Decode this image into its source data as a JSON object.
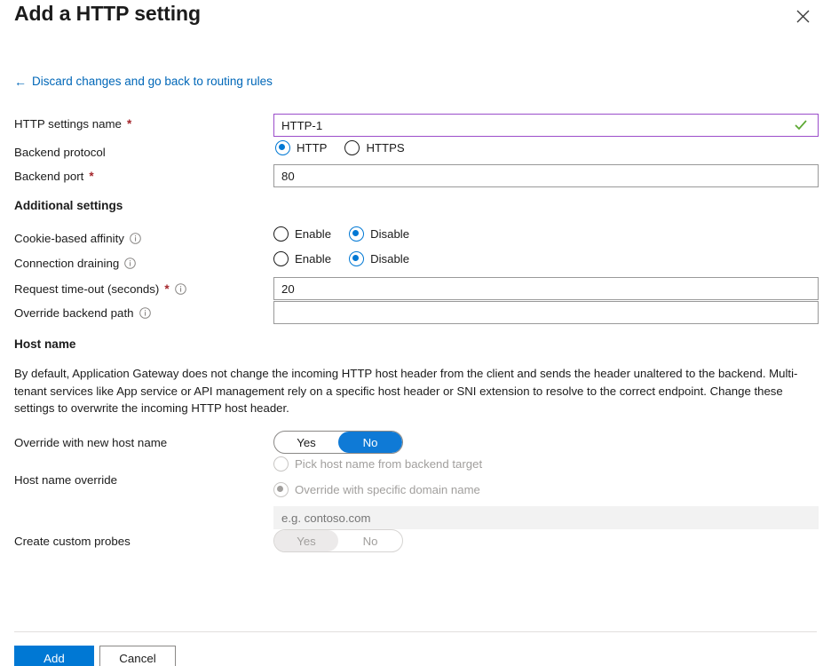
{
  "header": {
    "title": "Add a HTTP setting",
    "close_icon": "close-icon"
  },
  "back_link": {
    "arrow": "←",
    "label": "Discard changes and go back to routing rules"
  },
  "form": {
    "http_settings_name": {
      "label": "HTTP settings name",
      "required_marker": "*",
      "value": "HTTP-1",
      "valid_icon": "checkmark-icon"
    },
    "backend_protocol": {
      "label": "Backend protocol",
      "options": [
        "HTTP",
        "HTTPS"
      ],
      "selected": "HTTP"
    },
    "backend_port": {
      "label": "Backend port",
      "required_marker": "*",
      "value": "80"
    }
  },
  "additional_settings": {
    "heading": "Additional settings",
    "cookie_based_affinity": {
      "label": "Cookie-based affinity",
      "info_icon": "info-icon",
      "options": [
        "Enable",
        "Disable"
      ],
      "selected": "Disable"
    },
    "connection_draining": {
      "label": "Connection draining",
      "info_icon": "info-icon",
      "options": [
        "Enable",
        "Disable"
      ],
      "selected": "Disable"
    },
    "request_timeout": {
      "label": "Request time-out (seconds)",
      "required_marker": "*",
      "info_icon": "info-icon",
      "value": "20"
    },
    "override_backend_path": {
      "label": "Override backend path",
      "info_icon": "info-icon",
      "value": ""
    }
  },
  "host_name": {
    "heading": "Host name",
    "description": "By default, Application Gateway does not change the incoming HTTP host header from the client and sends the header unaltered to the backend. Multi-tenant services like App service or API management rely on a specific host header or SNI extension to resolve to the correct endpoint. Change these settings to overwrite the incoming HTTP host header.",
    "override_with_new_host_name": {
      "label": "Override with new host name",
      "options": [
        "Yes",
        "No"
      ],
      "selected": "No"
    },
    "host_name_override": {
      "label": "Host name override",
      "options": [
        "Pick host name from backend target",
        "Override with specific domain name"
      ],
      "selected": "Override with specific domain name",
      "disabled": true
    },
    "domain_name_field": {
      "placeholder": "e.g. contoso.com",
      "value": "",
      "disabled": true
    },
    "create_custom_probes": {
      "label": "Create custom probes",
      "options": [
        "Yes",
        "No"
      ],
      "selected": "Yes",
      "disabled": true
    }
  },
  "footer": {
    "add_label": "Add",
    "cancel_label": "Cancel"
  },
  "colors": {
    "accent": "#0078d4",
    "link": "#0067b8",
    "required": "#a4262c",
    "focus_border": "#9b4dca",
    "valid_green": "#5ba832",
    "toggle_on": "#0f7ad6"
  }
}
